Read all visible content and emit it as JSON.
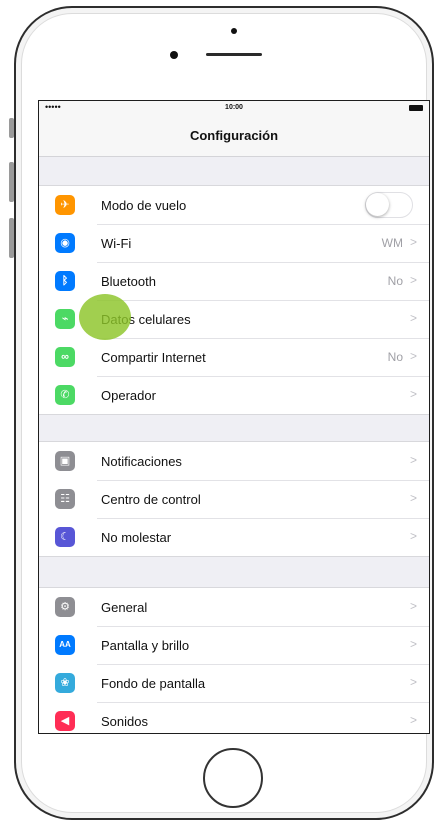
{
  "status_bar": {
    "signal": "•••••",
    "time": "10:00"
  },
  "nav": {
    "title": "Configuración"
  },
  "groups": [
    {
      "rows": [
        {
          "label": "Modo de vuelo",
          "icon": "airplane-icon",
          "color": "#ff9500",
          "glyph": "✈",
          "detail": "",
          "control": "toggle-off"
        },
        {
          "label": "Wi-Fi",
          "icon": "wifi-icon",
          "color": "#007aff",
          "glyph": "◉",
          "detail": "WM"
        },
        {
          "label": "Bluetooth",
          "icon": "bluetooth-icon",
          "color": "#007aff",
          "glyph": "ᛒ",
          "detail": "No"
        },
        {
          "label": "Datos celulares",
          "icon": "cellular-icon",
          "color": "#4cd964",
          "glyph": "⌁",
          "detail": ""
        },
        {
          "label": "Compartir Internet",
          "icon": "hotspot-icon",
          "color": "#4cd964",
          "glyph": "∞",
          "detail": "No"
        },
        {
          "label": "Operador",
          "icon": "phone-icon",
          "color": "#4cd964",
          "glyph": "✆",
          "detail": ""
        }
      ]
    },
    {
      "rows": [
        {
          "label": "Notificaciones",
          "icon": "notifications-icon",
          "color": "#8e8e93",
          "glyph": "▣",
          "detail": ""
        },
        {
          "label": "Centro de control",
          "icon": "control-center-icon",
          "color": "#8e8e93",
          "glyph": "☷",
          "detail": ""
        },
        {
          "label": "No molestar",
          "icon": "moon-icon",
          "color": "#5856d6",
          "glyph": "☾",
          "detail": ""
        }
      ]
    },
    {
      "rows": [
        {
          "label": "General",
          "icon": "gear-icon",
          "color": "#8e8e93",
          "glyph": "⚙",
          "detail": ""
        },
        {
          "label": "Pantalla y brillo",
          "icon": "display-icon",
          "color": "#007aff",
          "glyph": "AA",
          "detail": ""
        },
        {
          "label": "Fondo de pantalla",
          "icon": "wallpaper-icon",
          "color": "#34aadc",
          "glyph": "❀",
          "detail": ""
        },
        {
          "label": "Sonidos",
          "icon": "sounds-icon",
          "color": "#ff2d55",
          "glyph": "◀",
          "detail": ""
        }
      ]
    }
  ],
  "chevron": ">"
}
